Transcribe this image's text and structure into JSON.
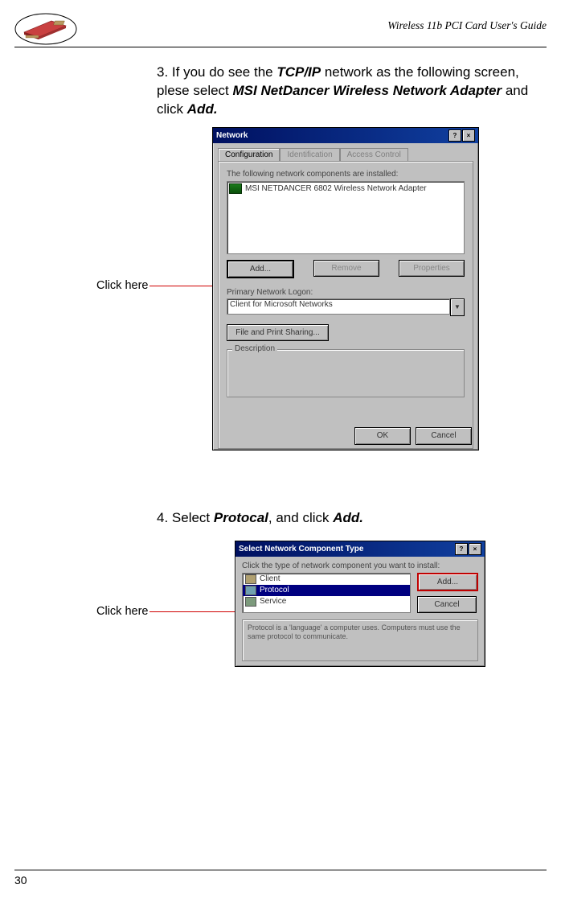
{
  "header": {
    "title": "Wireless 11b PCI Card User's Guide"
  },
  "step3": {
    "text_prefix": "3. If you do see the ",
    "tcpip": "TCP/IP",
    "text_mid": " network as the following screen, plese select ",
    "adapter": "MSI NetDancer Wireless Network Adapter",
    "text_mid2": " and click ",
    "add": "Add."
  },
  "click_here_1": "Click here",
  "net_dialog": {
    "title": "Network",
    "tabs": {
      "configuration": "Configuration",
      "identification": "Identification",
      "access_control": "Access Control"
    },
    "installed_label": "The following network components are installed:",
    "list_item": "MSI NETDANCER 6802 Wireless Network Adapter",
    "btn_add": "Add...",
    "btn_remove": "Remove",
    "btn_properties": "Properties",
    "primary_label": "Primary Network Logon:",
    "primary_value": "Client for Microsoft Networks",
    "fps": "File and Print Sharing...",
    "description": "Description",
    "ok": "OK",
    "cancel": "Cancel"
  },
  "step4": {
    "text_prefix": "4. Select ",
    "protocol": "Protocal",
    "text_mid": ", and click ",
    "add": "Add."
  },
  "click_here_2": "Click here",
  "comp_dialog": {
    "title": "Select Network Component Type",
    "prompt": "Click the type of network component you want to install:",
    "client": "Client",
    "protocol": "Protocol",
    "service": "Service",
    "add": "Add...",
    "cancel": "Cancel",
    "desc": "Protocol is a 'language' a computer uses. Computers must use the same protocol to communicate."
  },
  "page_number": "30"
}
